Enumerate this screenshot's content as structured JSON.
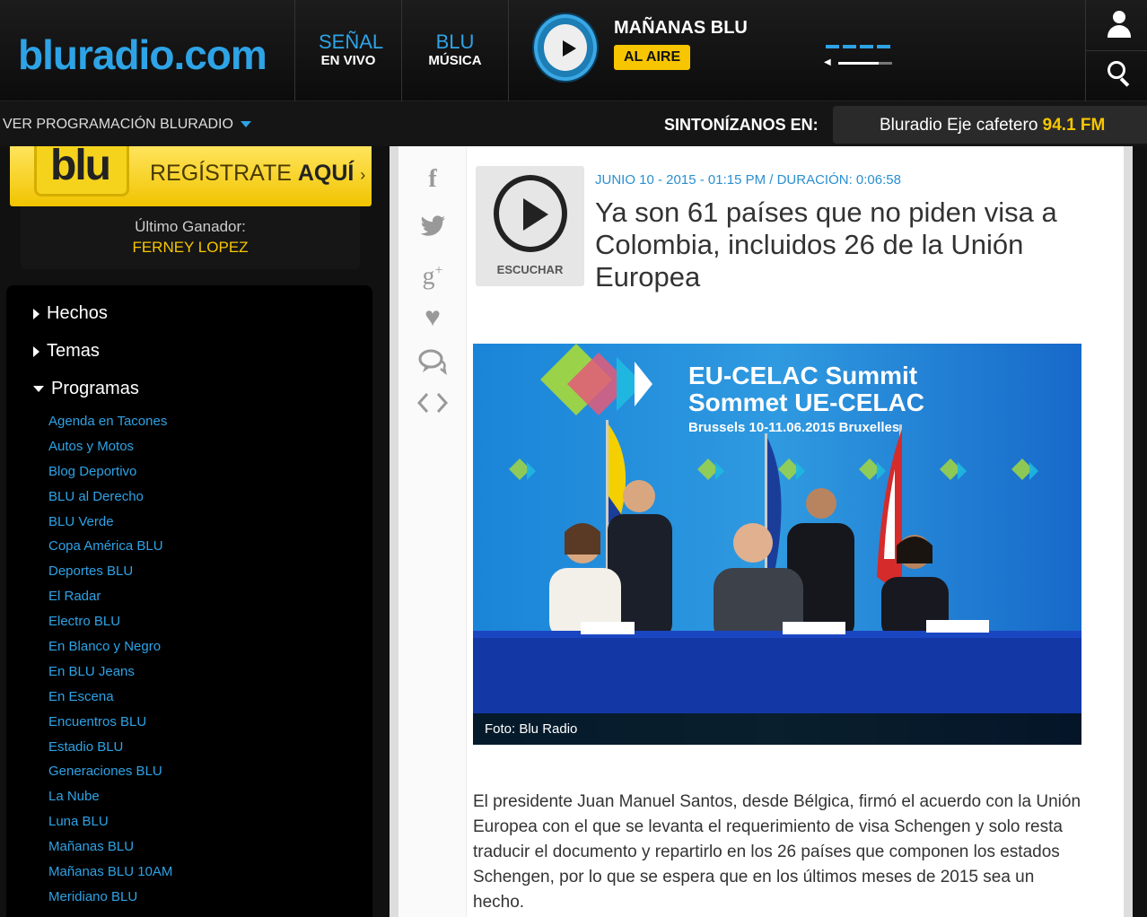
{
  "header": {
    "logo_text": "bluradio.com",
    "tabs": [
      {
        "line1": "SEÑAL",
        "line2": "EN VIVO"
      },
      {
        "line1": "BLU",
        "line2": "MÚSICA"
      }
    ],
    "show_title": "MAÑANAS BLU",
    "on_air_label": "AL AIRE",
    "icons": [
      "play-icon",
      "volume-icon",
      "user-icon",
      "search-icon"
    ]
  },
  "subbar": {
    "programming_link": "VER PROGRAMACIÓN BLURADIO",
    "tune_label": "SINTONÍZANOS EN:",
    "station_name": "Bluradio Eje cafetero",
    "frequency": "94.1 FM"
  },
  "sidebar": {
    "promo": {
      "brand": "blu",
      "text": "REGÍSTRATE",
      "bold": "AQUÍ",
      "arrow": "›"
    },
    "winner_label": "Último Ganador:",
    "winner_name": "FERNEY LOPEZ",
    "categories": [
      "Hechos",
      "Temas",
      "Programas"
    ],
    "programs": [
      "Agenda en Tacones",
      "Autos y Motos",
      "Blog Deportivo",
      "BLU al Derecho",
      "BLU Verde",
      "Copa América BLU",
      "Deportes BLU",
      "El Radar",
      "Electro BLU",
      "En Blanco y Negro",
      "En BLU Jeans",
      "En Escena",
      "Encuentros BLU",
      "Estadio BLU",
      "Generaciones BLU",
      "La Nube",
      "Luna BLU",
      "Mañanas BLU",
      "Mañanas BLU 10AM",
      "Meridiano BLU"
    ]
  },
  "article": {
    "share_icons": [
      "facebook-icon",
      "twitter-icon",
      "google-plus-icon",
      "heart-icon",
      "comment-icon",
      "embed-icon"
    ],
    "listen_label": "ESCUCHAR",
    "meta": "JUNIO 10 - 2015 - 01:15 PM / DURACIÓN: 0:06:58",
    "headline": "Ya son 61 países que no piden visa a Colombia, incluidos 26 de la Unión Europea",
    "photo_banner_line1": "EU-CELAC Summit",
    "photo_banner_line2": "Sommet UE-CELAC",
    "photo_banner_line3": "Brussels 10-11.06.2015 Bruxelles",
    "photo_caption": "Foto: Blu Radio",
    "body": "El presidente Juan Manuel Santos, desde Bélgica, firmó el acuerdo con la Unión Europea con el que se levanta el requerimiento de visa Schengen y solo resta traducir el documento y repartirlo en los 26 países que componen los estados Schengen, por lo que se espera que en los últimos meses de 2015 sea un hecho."
  },
  "colors": {
    "accent_blue": "#2ea3e6",
    "accent_yellow": "#f7c600",
    "header_bg": "#111111"
  }
}
